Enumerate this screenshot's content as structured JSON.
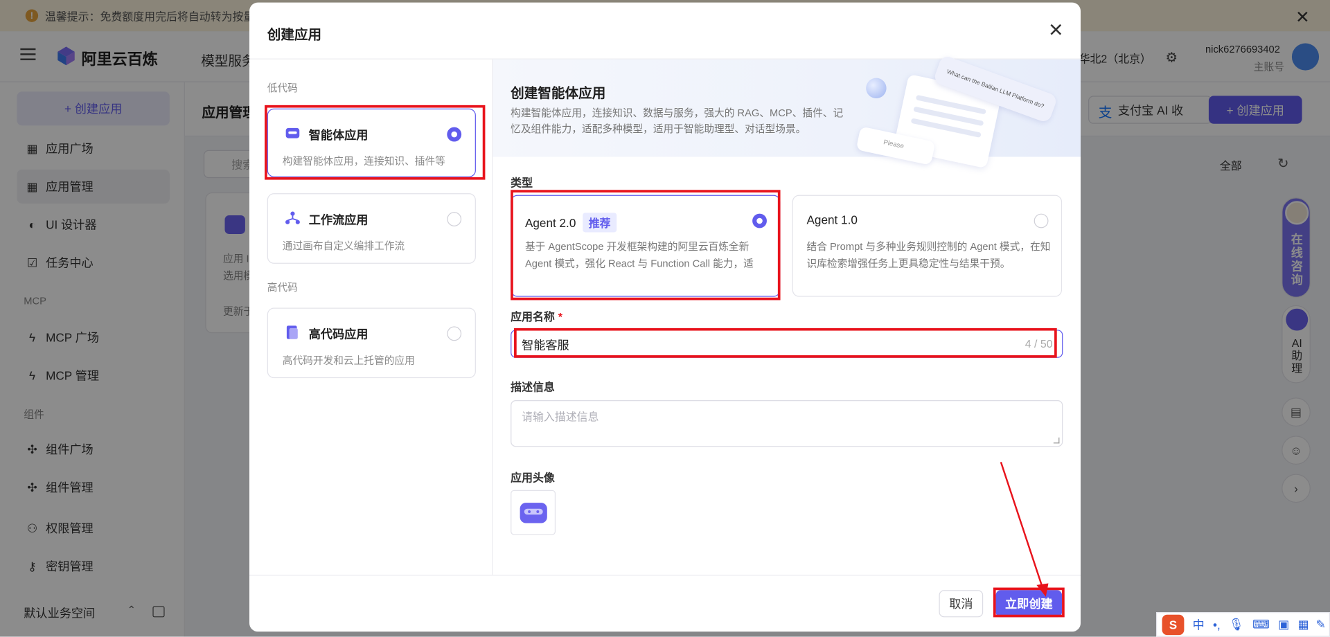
{
  "notice": {
    "text": "温馨提示：免费额度用完后将自动转为按量付"
  },
  "topbar": {
    "brand": "阿里云百炼",
    "nav_item": "模型服务",
    "region": "华北2（北京）",
    "username": "nick6276693402",
    "account_type": "主账号"
  },
  "sidebar": {
    "create_label": "+ 创建应用",
    "items": [
      {
        "label": "应用广场",
        "icon": "grid-icon"
      },
      {
        "label": "应用管理",
        "icon": "grid-icon"
      },
      {
        "label": "UI 设计器",
        "icon": "palette-icon"
      },
      {
        "label": "任务中心",
        "icon": "task-icon"
      }
    ],
    "group_mcp": "MCP",
    "mcp_items": [
      {
        "label": "MCP 广场",
        "icon": "lightning-icon"
      },
      {
        "label": "MCP 管理",
        "icon": "lightning-gear-icon"
      }
    ],
    "group_components": "组件",
    "component_items": [
      {
        "label": "组件广场",
        "icon": "puzzle-icon"
      },
      {
        "label": "组件管理",
        "icon": "puzzle-gear-icon"
      }
    ],
    "other_items": [
      {
        "label": "权限管理",
        "icon": "user-icon"
      },
      {
        "label": "密钥管理",
        "icon": "key-icon"
      }
    ],
    "workspace": "默认业务空间"
  },
  "main": {
    "page_title": "应用管理",
    "search_placeholder": "搜索",
    "alipay_label": "支付宝 AI 收",
    "create_label": "+ 创建应用",
    "filter_label": "全部",
    "card_lines": [
      "应用 I",
      "选用模",
      "更新于"
    ]
  },
  "modal": {
    "title": "创建应用",
    "lowcode_group": "低代码",
    "highcode_group": "高代码",
    "app_types": [
      {
        "title": "智能体应用",
        "desc": "构建智能体应用，连接知识、插件等",
        "selected": true
      },
      {
        "title": "工作流应用",
        "desc": "通过画布自定义编排工作流",
        "selected": false
      }
    ],
    "highcode_types": [
      {
        "title": "高代码应用",
        "desc": "高代码开发和云上托管的应用",
        "selected": false
      }
    ],
    "banner": {
      "title": "创建智能体应用",
      "desc": "构建智能体应用，连接知识、数据与服务，强大的 RAG、MCP、插件、记忆及组件能力，适配多种模型，适用于智能助理型、对话型场景。",
      "illustration_text": "What can the Bailian LLM Platform do?",
      "illustration_input": "Please"
    },
    "type_label": "类型",
    "agent_types": [
      {
        "title": "Agent 2.0",
        "badge": "推荐",
        "desc": "基于 AgentScope 开发框架构建的阿里云百炼全新 Agent 模式，强化 React 与 Function Call 能力，适用...",
        "selected": true
      },
      {
        "title": "Agent 1.0",
        "badge": "",
        "desc": "结合 Prompt 与多种业务规则控制的 Agent 模式，在知识库检索增强任务上更具稳定性与结果干预。",
        "selected": false
      }
    ],
    "name_label": "应用名称",
    "name_required": "*",
    "name_value": "智能客服",
    "name_count": "4 / 50",
    "desc_label": "描述信息",
    "desc_placeholder": "请输入描述信息",
    "avatar_label": "应用头像",
    "cancel_label": "取消",
    "create_label": "立即创建"
  },
  "right_float": {
    "consult_label": "在线咨询",
    "assistant_label": "AI助理"
  },
  "ime": {
    "lang": "中"
  },
  "colors": {
    "accent": "#615ced",
    "annotation": "#e8131c",
    "notice_bg": "#fbf3dc"
  }
}
